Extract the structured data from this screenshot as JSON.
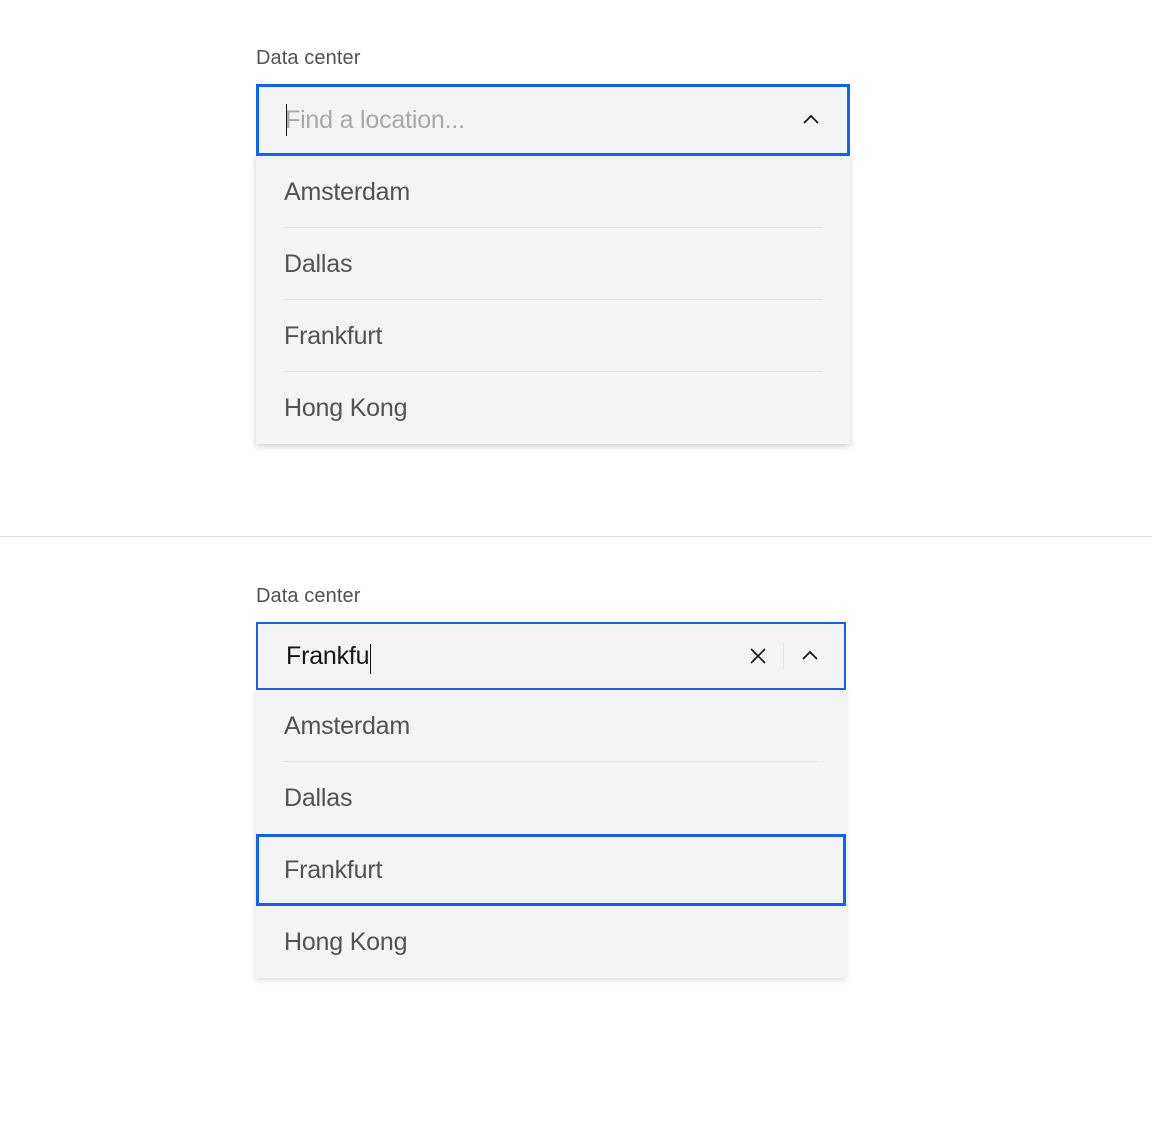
{
  "colors": {
    "focus_border": "#0f62fe",
    "background_input": "#f4f4f4",
    "text_primary": "#161616",
    "text_secondary": "#525252",
    "placeholder": "#a8a8a8",
    "divider": "#e0e0e0"
  },
  "combobox1": {
    "label": "Data center",
    "placeholder": "Find a location...",
    "value": "",
    "options": [
      "Amsterdam",
      "Dallas",
      "Frankfurt",
      "Hong Kong"
    ]
  },
  "combobox2": {
    "label": "Data center",
    "value": "Frankfu",
    "options": [
      "Amsterdam",
      "Dallas",
      "Frankfurt",
      "Hong Kong"
    ],
    "highlighted_index": 2
  },
  "icons": {
    "chevron_up": "chevron-up-icon",
    "close": "close-icon"
  }
}
